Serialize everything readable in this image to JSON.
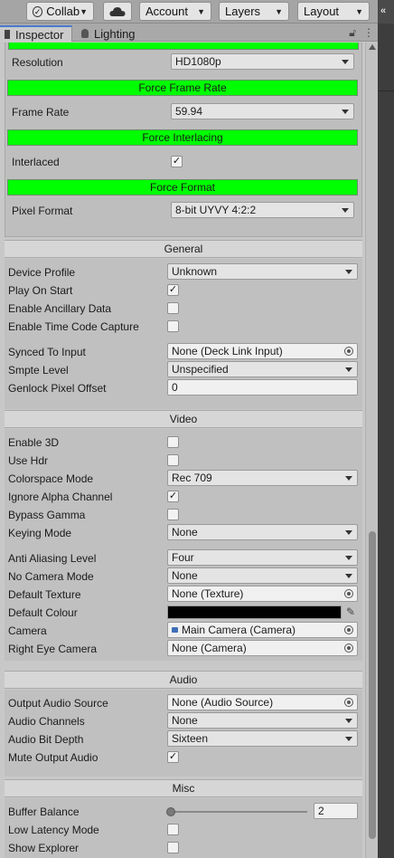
{
  "toolbar": {
    "collab": "Collab",
    "account": "Account",
    "layers": "Layers",
    "layout": "Layout"
  },
  "tabs": {
    "inspector": "Inspector",
    "lighting": "Lighting"
  },
  "force": {
    "resolution_label": "Resolution",
    "resolution_value": "HD1080p",
    "frame_rate_bar": "Force Frame Rate",
    "frame_rate_label": "Frame Rate",
    "frame_rate_value": "59.94",
    "interlacing_bar": "Force Interlacing",
    "interlaced_label": "Interlaced",
    "interlaced_checked": "✓",
    "format_bar": "Force Format",
    "pixel_format_label": "Pixel Format",
    "pixel_format_value": "8-bit UYVY 4:2:2"
  },
  "general": {
    "header": "General",
    "device_profile_label": "Device Profile",
    "device_profile_value": "Unknown",
    "play_on_start_label": "Play On Start",
    "play_on_start_check": "✓",
    "ancillary_label": "Enable Ancillary Data",
    "timecode_label": "Enable Time Code Capture",
    "synced_label": "Synced To Input",
    "synced_value": "None (Deck Link Input)",
    "smpte_label": "Smpte Level",
    "smpte_value": "Unspecified",
    "genlock_label": "Genlock Pixel Offset",
    "genlock_value": "0"
  },
  "video": {
    "header": "Video",
    "enable3d_label": "Enable 3D",
    "hdr_label": "Use Hdr",
    "colorspace_label": "Colorspace Mode",
    "colorspace_value": "Rec 709",
    "ignore_alpha_label": "Ignore Alpha Channel",
    "ignore_alpha_check": "✓",
    "bypass_gamma_label": "Bypass Gamma",
    "keying_label": "Keying Mode",
    "keying_value": "None",
    "aa_label": "Anti Aliasing Level",
    "aa_value": "Four",
    "no_camera_label": "No Camera Mode",
    "no_camera_value": "None",
    "default_texture_label": "Default Texture",
    "default_texture_value": "None (Texture)",
    "default_colour_label": "Default Colour",
    "default_colour_hex": "#000000",
    "camera_label": "Camera",
    "camera_value": "Main Camera (Camera)",
    "right_eye_label": "Right Eye Camera",
    "right_eye_value": "None (Camera)"
  },
  "audio": {
    "header": "Audio",
    "output_source_label": "Output Audio Source",
    "output_source_value": "None (Audio Source)",
    "channels_label": "Audio Channels",
    "channels_value": "None",
    "bit_depth_label": "Audio Bit Depth",
    "bit_depth_value": "Sixteen",
    "mute_label": "Mute Output Audio",
    "mute_check": "✓"
  },
  "misc": {
    "header": "Misc",
    "buffer_label": "Buffer Balance",
    "buffer_value": "2",
    "low_latency_label": "Low Latency Mode",
    "show_explorer_label": "Show Explorer"
  },
  "colors": {
    "force_bar": "#00ff00",
    "accent": "#4a7bd0"
  }
}
